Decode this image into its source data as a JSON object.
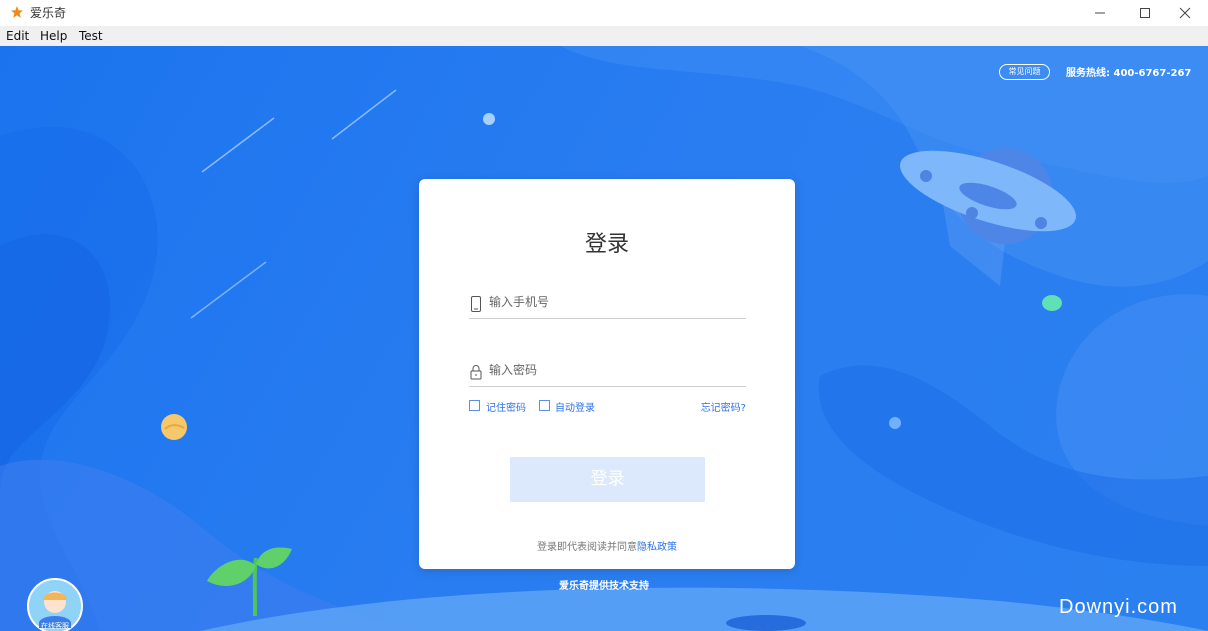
{
  "window": {
    "title": "爱乐奇"
  },
  "menu": {
    "items": [
      "Edit",
      "Help",
      "Test"
    ]
  },
  "header": {
    "faq_label": "常见问题",
    "hotline": "服务热线: 400-6767-267"
  },
  "login": {
    "title": "登录",
    "phone_placeholder": "输入手机号",
    "password_placeholder": "输入密码",
    "remember_label": "记住密码",
    "auto_login_label": "自动登录",
    "forgot_label": "忘记密码?",
    "submit_label": "登录",
    "agree_text": "登录即代表阅读并同意",
    "policy_link": "隐私政策"
  },
  "footer": {
    "support": "爱乐奇提供技术支持",
    "service_badge": "在线客服"
  },
  "watermark": "Downyi.com",
  "colors": {
    "background": "#1b74ee",
    "accent": "#2e73e8",
    "button_disabled": "#dce9fc"
  }
}
